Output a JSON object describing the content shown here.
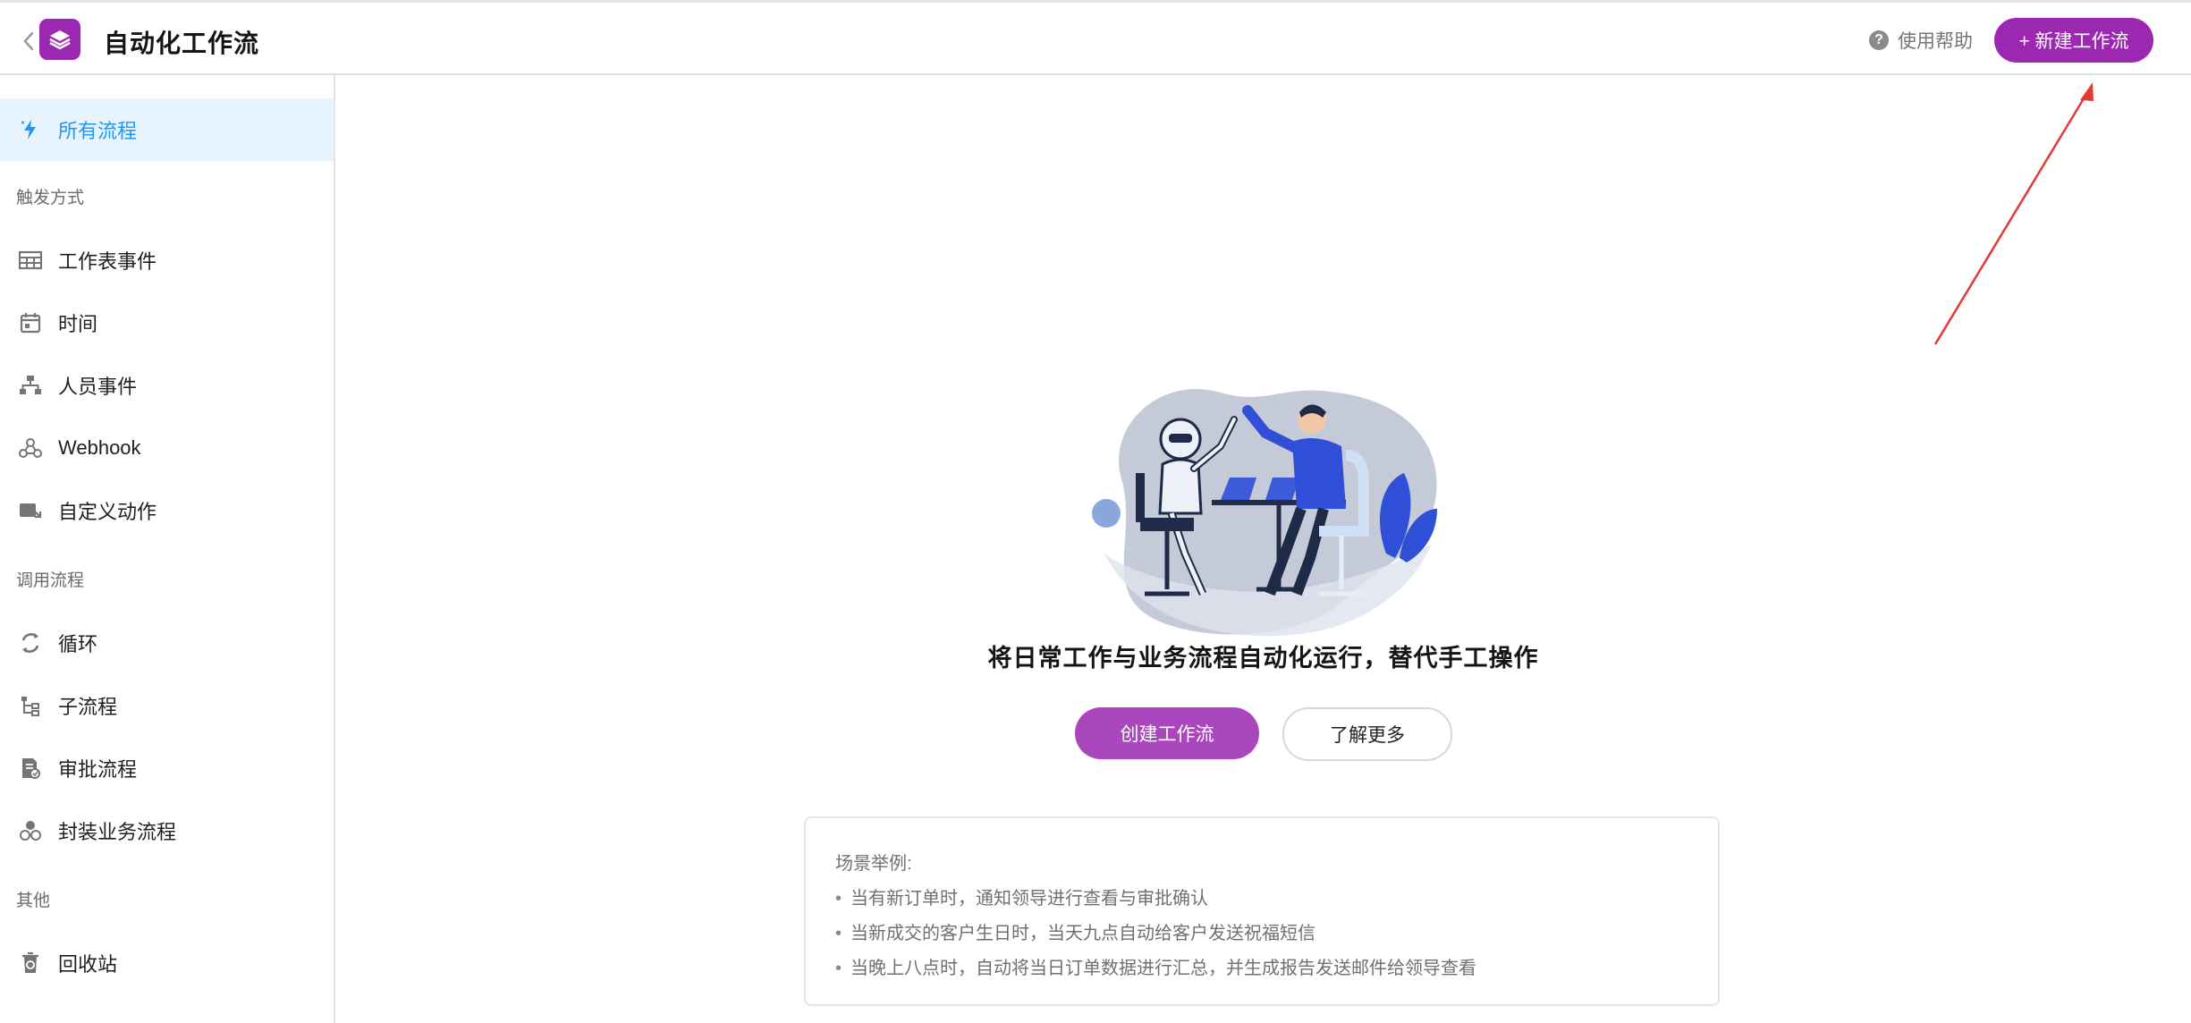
{
  "header": {
    "title": "自动化工作流",
    "help_label": "使用帮助",
    "new_button_label": "+ 新建工作流",
    "accent_color": "#9c27b0"
  },
  "sidebar": {
    "active": {
      "label": "所有流程",
      "icon": "flash-icon"
    },
    "groups": [
      {
        "label": "触发方式",
        "items": [
          {
            "label": "工作表事件",
            "icon": "table-icon"
          },
          {
            "label": "时间",
            "icon": "calendar-icon"
          },
          {
            "label": "人员事件",
            "icon": "org-chart-icon"
          },
          {
            "label": "Webhook",
            "icon": "webhook-icon"
          },
          {
            "label": "自定义动作",
            "icon": "custom-action-icon"
          }
        ]
      },
      {
        "label": "调用流程",
        "items": [
          {
            "label": "循环",
            "icon": "loop-icon"
          },
          {
            "label": "子流程",
            "icon": "subprocess-icon"
          },
          {
            "label": "审批流程",
            "icon": "approval-icon"
          },
          {
            "label": "封装业务流程",
            "icon": "package-icon"
          }
        ]
      },
      {
        "label": "其他",
        "items": [
          {
            "label": "回收站",
            "icon": "trash-icon"
          }
        ]
      }
    ]
  },
  "main": {
    "tagline": "将日常工作与业务流程自动化运行，替代手工操作",
    "create_button_label": "创建工作流",
    "learn_more_label": "了解更多",
    "examples": {
      "title": "场景举例:",
      "items": [
        "当有新订单时，通知领导进行查看与审批确认",
        "当新成交的客户生日时，当天九点自动给客户发送祝福短信",
        "当晚上八点时，自动将当日订单数据进行汇总，并生成报告发送邮件给领导查看"
      ]
    }
  }
}
